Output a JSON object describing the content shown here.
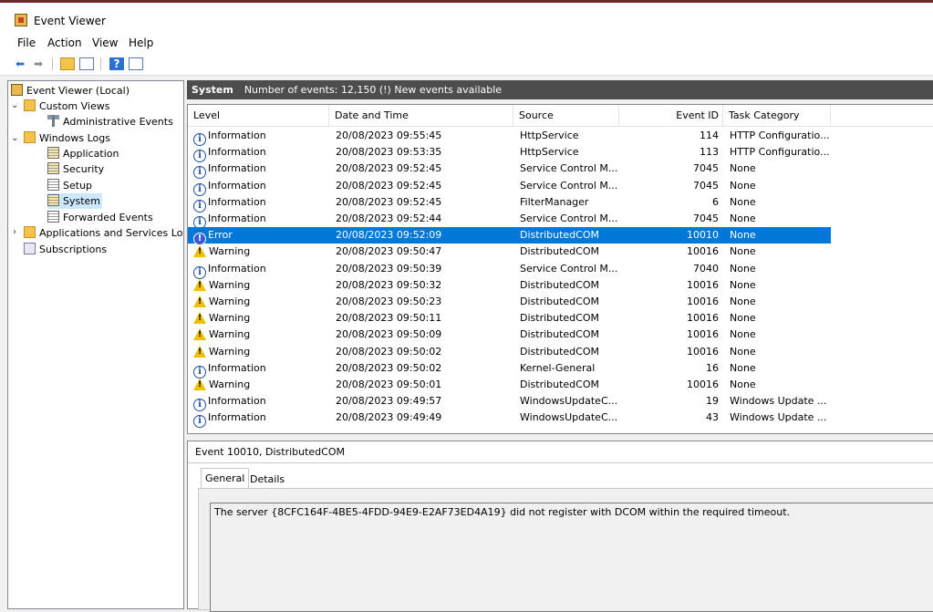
{
  "window": {
    "title": "Event Viewer"
  },
  "menu": [
    "File",
    "Action",
    "View",
    "Help"
  ],
  "toolbar": {
    "icons": [
      "back-arrow-icon",
      "forward-arrow-icon",
      "up-folder-icon",
      "show-hide-tree-icon",
      "help-icon",
      "show-hide-action-pane-icon"
    ]
  },
  "tree": {
    "root": "Event Viewer (Local)",
    "custom_views": "Custom Views",
    "administrative_events": "Administrative Events",
    "windows_logs": "Windows Logs",
    "application": "Application",
    "security": "Security",
    "setup": "Setup",
    "system": "System",
    "forwarded_events": "Forwarded Events",
    "apps_services": "Applications and Services Lo",
    "subscriptions": "Subscriptions"
  },
  "header": {
    "log_name": "System",
    "summary": "Number of events: 12,150 (!) New events available"
  },
  "columns": [
    "Level",
    "Date and Time",
    "Source",
    "Event ID",
    "Task Category"
  ],
  "events": [
    {
      "level": "Information",
      "type": "info",
      "date": "20/08/2023 09:55:45",
      "source": "HttpService",
      "id": "114",
      "category": "HTTP Configuratio..."
    },
    {
      "level": "Information",
      "type": "info",
      "date": "20/08/2023 09:53:35",
      "source": "HttpService",
      "id": "113",
      "category": "HTTP Configuratio..."
    },
    {
      "level": "Information",
      "type": "info",
      "date": "20/08/2023 09:52:45",
      "source": "Service Control M...",
      "id": "7045",
      "category": "None"
    },
    {
      "level": "Information",
      "type": "info",
      "date": "20/08/2023 09:52:45",
      "source": "Service Control M...",
      "id": "7045",
      "category": "None"
    },
    {
      "level": "Information",
      "type": "info",
      "date": "20/08/2023 09:52:45",
      "source": "FilterManager",
      "id": "6",
      "category": "None"
    },
    {
      "level": "Information",
      "type": "info",
      "date": "20/08/2023 09:52:44",
      "source": "Service Control M...",
      "id": "7045",
      "category": "None"
    },
    {
      "level": "Error",
      "type": "error",
      "date": "20/08/2023 09:52:09",
      "source": "DistributedCOM",
      "id": "10010",
      "category": "None",
      "selected": true
    },
    {
      "level": "Warning",
      "type": "warn",
      "date": "20/08/2023 09:50:47",
      "source": "DistributedCOM",
      "id": "10016",
      "category": "None"
    },
    {
      "level": "Information",
      "type": "info",
      "date": "20/08/2023 09:50:39",
      "source": "Service Control M...",
      "id": "7040",
      "category": "None"
    },
    {
      "level": "Warning",
      "type": "warn",
      "date": "20/08/2023 09:50:32",
      "source": "DistributedCOM",
      "id": "10016",
      "category": "None"
    },
    {
      "level": "Warning",
      "type": "warn",
      "date": "20/08/2023 09:50:23",
      "source": "DistributedCOM",
      "id": "10016",
      "category": "None"
    },
    {
      "level": "Warning",
      "type": "warn",
      "date": "20/08/2023 09:50:11",
      "source": "DistributedCOM",
      "id": "10016",
      "category": "None"
    },
    {
      "level": "Warning",
      "type": "warn",
      "date": "20/08/2023 09:50:09",
      "source": "DistributedCOM",
      "id": "10016",
      "category": "None"
    },
    {
      "level": "Warning",
      "type": "warn",
      "date": "20/08/2023 09:50:02",
      "source": "DistributedCOM",
      "id": "10016",
      "category": "None"
    },
    {
      "level": "Information",
      "type": "info",
      "date": "20/08/2023 09:50:02",
      "source": "Kernel-General",
      "id": "16",
      "category": "None"
    },
    {
      "level": "Warning",
      "type": "warn",
      "date": "20/08/2023 09:50:01",
      "source": "DistributedCOM",
      "id": "10016",
      "category": "None"
    },
    {
      "level": "Information",
      "type": "info",
      "date": "20/08/2023 09:49:57",
      "source": "WindowsUpdateC...",
      "id": "19",
      "category": "Windows Update ..."
    },
    {
      "level": "Information",
      "type": "info",
      "date": "20/08/2023 09:49:49",
      "source": "WindowsUpdateC...",
      "id": "43",
      "category": "Windows Update ..."
    }
  ],
  "detail": {
    "title": "Event 10010, DistributedCOM",
    "tabs": [
      "General",
      "Details"
    ],
    "message": "The server {8CFC164F-4BE5-4FDD-94E9-E2AF73ED4A19} did not register with DCOM within the required timeout."
  }
}
